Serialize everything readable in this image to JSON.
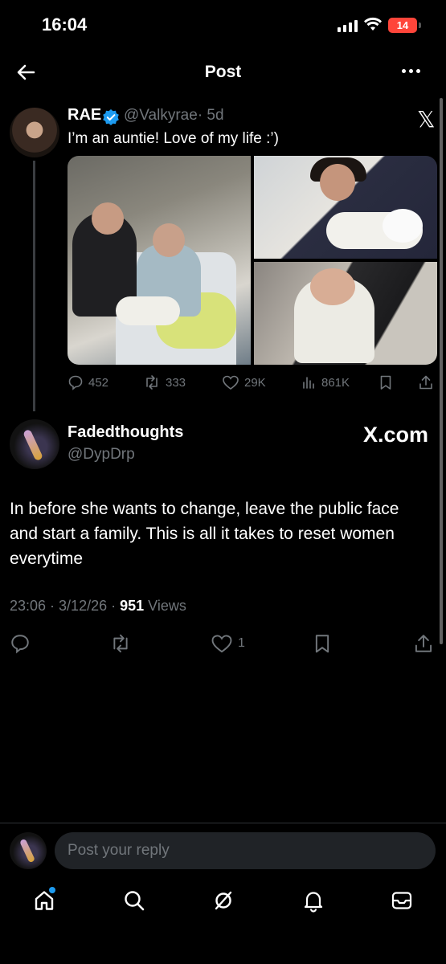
{
  "status_bar": {
    "time": "16:04",
    "battery": "14",
    "battery_color": "#ff453a"
  },
  "header": {
    "title": "Post",
    "back_icon": "arrow-left-icon",
    "more_icon": "more-horizontal-icon"
  },
  "quoted_post": {
    "name": "RAE",
    "handle": "@Valkyrae",
    "time": "· 5d",
    "text": "I’m an auntie! Love of my life :’)",
    "verified_color": "#1d9bf0",
    "x_logo": "𝕏",
    "images": [
      "hospital-bed-photo",
      "holding-newborn-photo",
      "sleeping-newborn-photo"
    ],
    "stats": {
      "replies": "452",
      "reposts": "333",
      "likes": "29K",
      "views": "861K"
    }
  },
  "main_post": {
    "name": "Fadedthoughts",
    "handle": "@DypDrp",
    "watermark": "X.com",
    "text": "In before she wants to change, leave the public face and start a family. This is all it takes to reset women everytime",
    "time": "23:06 · 3/12/26 · ",
    "views_count": "951",
    "views_label": " Views",
    "likes": "1"
  },
  "reply": {
    "placeholder": "Post your reply"
  },
  "bottom_nav": [
    "home-icon",
    "search-icon",
    "grok-icon",
    "notifications-icon",
    "messages-icon"
  ],
  "colors": {
    "background": "#000000",
    "text": "#e7e9ea",
    "muted": "#71767b",
    "accent": "#1d9bf0"
  }
}
